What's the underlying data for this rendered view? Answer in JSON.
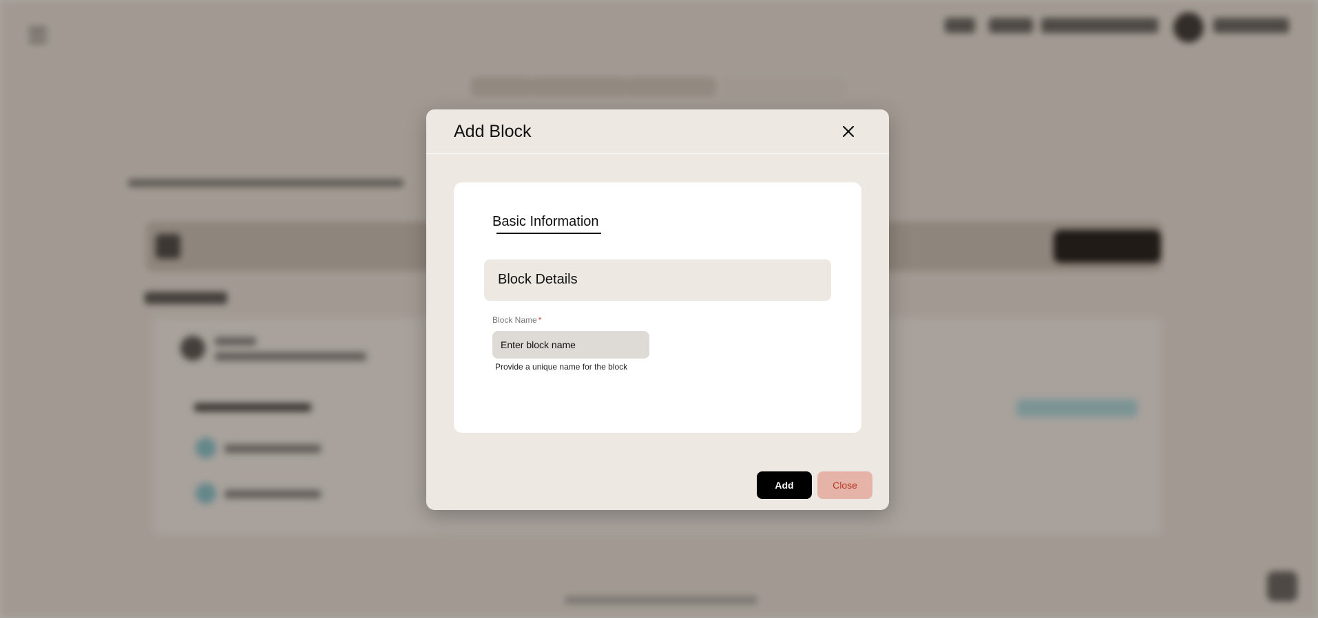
{
  "modal": {
    "title": "Add Block",
    "close_icon": "close-icon",
    "tab_label": "Basic Information",
    "section_title": "Block Details",
    "field": {
      "label": "Block Name",
      "required_marker": "*",
      "placeholder": "Enter block name",
      "value": "",
      "help_text": "Provide a unique name for the block"
    },
    "add_label": "Add",
    "close_label": "Close"
  },
  "colors": {
    "modal_bg": "#ede8e1",
    "primary_button": "#000000",
    "secondary_button_bg": "#e6b3a8",
    "secondary_button_text": "#b33a24",
    "required": "#d23b2a"
  }
}
